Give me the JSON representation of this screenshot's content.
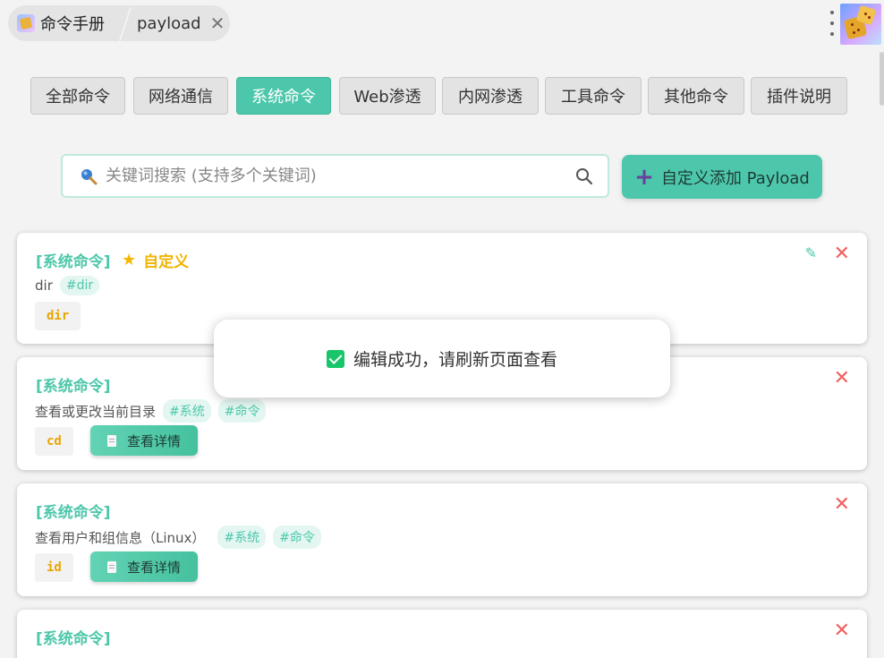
{
  "browser": {
    "tabs": [
      {
        "label": "命令手册"
      },
      {
        "label": "payload",
        "close": "✕"
      }
    ]
  },
  "categories": [
    {
      "label": "全部命令",
      "active": false
    },
    {
      "label": "网络通信",
      "active": false
    },
    {
      "label": "系统命令",
      "active": true
    },
    {
      "label": "Web渗透",
      "active": false
    },
    {
      "label": "内网渗透",
      "active": false
    },
    {
      "label": "工具命令",
      "active": false
    },
    {
      "label": "其他命令",
      "active": false
    },
    {
      "label": "插件说明",
      "active": false
    }
  ],
  "search": {
    "placeholder": "关键词搜索 (支持多个关键词)",
    "value": "",
    "lead_icon": "magnifier-icon",
    "trail_icon": "search-icon"
  },
  "add_button": {
    "icon": "plus-icon",
    "label": "自定义添加 Payload"
  },
  "cards": [
    {
      "title": "[系统命令]",
      "custom_label": "自定义",
      "desc": "dir",
      "tags": [
        "#dir"
      ],
      "code": "dir",
      "has_detail": false,
      "has_edit": true
    },
    {
      "title": "[系统命令]",
      "desc": "查看或更改当前目录",
      "tags": [
        "#系统",
        "#命令"
      ],
      "code": "cd",
      "has_detail": true
    },
    {
      "title": "[系统命令]",
      "desc": "查看用户和组信息（Linux）",
      "tags": [
        "#系统",
        "#命令"
      ],
      "code": "id",
      "has_detail": true
    },
    {
      "title": "[系统命令]",
      "desc": "",
      "tags": [],
      "code": "",
      "has_detail": false
    }
  ],
  "detail_label": "查看详情",
  "toast": {
    "message": "编辑成功，请刷新页面查看"
  },
  "colors": {
    "accent": "#4dc7ab",
    "danger": "#f06060",
    "highlight": "#f0b400",
    "success": "#18c56b"
  }
}
